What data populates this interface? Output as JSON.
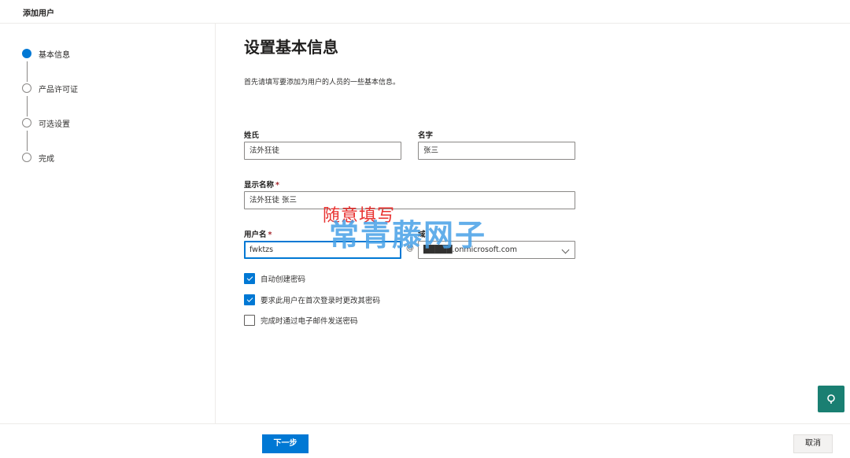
{
  "header": {
    "title": "添加用户"
  },
  "steps": [
    {
      "label": "基本信息",
      "active": true
    },
    {
      "label": "产品许可证",
      "active": false
    },
    {
      "label": "可选设置",
      "active": false
    },
    {
      "label": "完成",
      "active": false
    }
  ],
  "main": {
    "heading": "设置基本信息",
    "description": "首先请填写要添加为用户的人员的一些基本信息。",
    "last_name": {
      "label": "姓氏",
      "value": "法外狂徒"
    },
    "first_name": {
      "label": "名字",
      "value": "张三"
    },
    "display_name": {
      "label": "显示名称",
      "required_mark": "*",
      "value": "法外狂徒 张三"
    },
    "username": {
      "label": "用户名",
      "required_mark": "*",
      "value": "fwktzs"
    },
    "at_symbol": "@",
    "domain": {
      "label": "域",
      "value": "█████.onmicrosoft.com"
    },
    "checkboxes": [
      {
        "label": "自动创建密码",
        "checked": true
      },
      {
        "label": "要求此用户在首次登录时更改其密码",
        "checked": true
      },
      {
        "label": "完成时通过电子邮件发送密码",
        "checked": false
      }
    ]
  },
  "annotations": {
    "red_note": "随意填写",
    "watermark": "常青藤网子"
  },
  "footer": {
    "next_label": "下一步",
    "cancel_label": "取消"
  },
  "colors": {
    "accent": "#0078d4",
    "fab": "#1a7f72",
    "required": "#a4262c"
  },
  "icons": {
    "fab": "chat-help-icon",
    "dropdown": "chevron-down-icon"
  }
}
